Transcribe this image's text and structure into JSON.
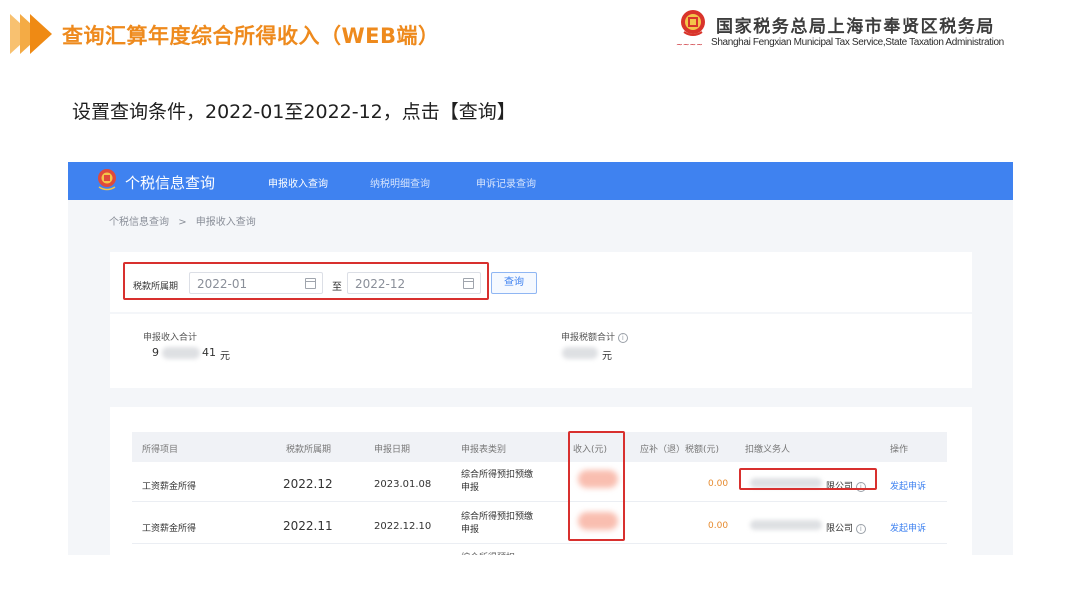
{
  "slide": {
    "title": "查询汇算年度综合所得收入（WEB端）",
    "instruction": "设置查询条件，2022-01至2022-12，点击【查询】",
    "bureau_name": "国家税务总局上海市奉贤区税务局",
    "bureau_name_en": "Shanghai Fengxian Municipal Tax Service,State Taxation Administration",
    "accent_color": "#ee8a1d"
  },
  "portal": {
    "app_title": "个税信息查询",
    "header_color": "#3f82f0",
    "nav": [
      {
        "label": "申报收入查询",
        "active": true
      },
      {
        "label": "纳税明细查询",
        "active": false
      },
      {
        "label": "申诉记录查询",
        "active": false
      }
    ],
    "breadcrumb": [
      "个税信息查询",
      ">",
      "申报收入查询"
    ],
    "query": {
      "period_label": "税款所属期",
      "start_value": "2022-01",
      "to_label": "至",
      "end_value": "2022-12",
      "search_button": "查询"
    },
    "summary": {
      "income_total_label": "申报收入合计",
      "income_total_prefix": "9",
      "income_total_suffix": "41",
      "income_unit": "元",
      "tax_total_label": "申报税额合计",
      "tax_unit": "元"
    },
    "table": {
      "columns": [
        "所得项目",
        "税款所属期",
        "申报日期",
        "申报表类别",
        "收入(元)",
        "应补（退）税额(元)",
        "扣缴义务人",
        "操作"
      ],
      "rows": [
        {
          "income_item": "工资薪金所得",
          "period": "2022.12",
          "date": "2023.01.08",
          "form_type": "综合所得预扣预缴申报",
          "tax": "0.00",
          "withholder_suffix": "限公司",
          "action": "发起申诉"
        },
        {
          "income_item": "工资薪金所得",
          "period": "2022.11",
          "date": "2022.12.10",
          "form_type": "综合所得预扣预缴申报",
          "tax": "0.00",
          "withholder_suffix": "限公司",
          "action": "发起申诉"
        }
      ],
      "partial_row_form_type": "综合所得预扣"
    }
  }
}
